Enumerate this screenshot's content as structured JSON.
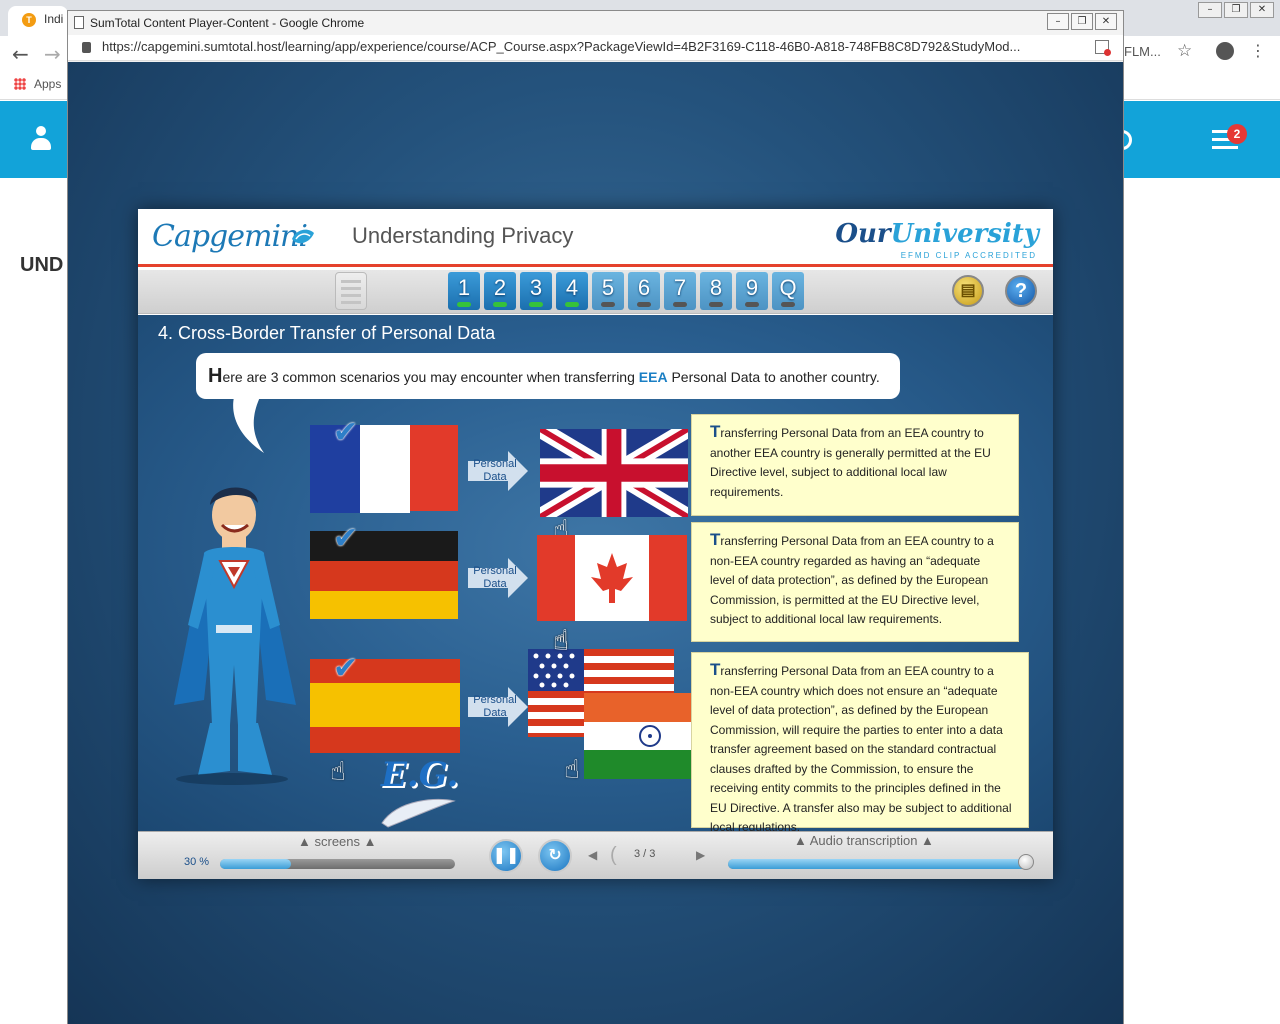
{
  "bg_window": {
    "tab_label": "Indi",
    "apps_label": "Apps",
    "url_fragment": "FLM...",
    "notification_count": "2",
    "page_heading": "UND"
  },
  "popup": {
    "title": "SumTotal Content Player-Content - Google Chrome",
    "url": "https://capgemini.sumtotal.host/learning/app/experience/course/ACP_Course.aspx?PackageViewId=4B2F3169-C118-46B0-A818-748FB8C8D792&StudyMod..."
  },
  "course": {
    "brand": "Capgemini",
    "title": "Understanding Privacy",
    "university_our": "Our",
    "university_name": "University",
    "accreditation": "EFMD CLIP ACCREDITED",
    "chapters": [
      {
        "label": "1",
        "done": true
      },
      {
        "label": "2",
        "done": true
      },
      {
        "label": "3",
        "done": true
      },
      {
        "label": "4",
        "done": true
      },
      {
        "label": "5",
        "done": false
      },
      {
        "label": "6",
        "done": false
      },
      {
        "label": "7",
        "done": false
      },
      {
        "label": "8",
        "done": false
      },
      {
        "label": "9",
        "done": false
      },
      {
        "label": "Q",
        "done": false
      }
    ],
    "help_label": "?",
    "section_title": "4. Cross-Border Transfer of Personal Data",
    "intro_cap": "H",
    "intro_before": "ere are 3 common scenarios you may encounter when transferring ",
    "intro_highlight": "EEA",
    "intro_after": " Personal Data to another country.",
    "arrow_label_1": "Personal",
    "arrow_label_2": "Data",
    "scenarios": [
      {
        "cap": "T",
        "text": "ransferring Personal Data from an EEA country to another EEA country is generally permitted at the EU Directive level, subject to additional local law requirements."
      },
      {
        "cap": "T",
        "text": "ransferring Personal Data from an EEA country to a non-EEA country regarded as having an “adequate level of data protection”, as defined by the European Commission, is permitted at the EU Directive level, subject to additional local law requirements."
      },
      {
        "cap": "T",
        "text": "ransferring Personal Data from an EEA country to a non-EEA country which does not ensure an “adequate level of data protection”, as defined by the European Commission, will require the parties to enter into a data transfer agreement based on the standard contractual clauses drafted by the Commission, to ensure the receiving entity commits to the principles defined in the EU Directive.  A transfer also may be subject to additional local regulations."
      }
    ],
    "eg_label": "E.G.",
    "controls": {
      "screens_label": "screens",
      "progress_text": "30 %",
      "progress_value": 0.3,
      "page_indicator": "3 / 3",
      "audio_label": "Audio transcription",
      "audio_value": 1.0
    }
  }
}
